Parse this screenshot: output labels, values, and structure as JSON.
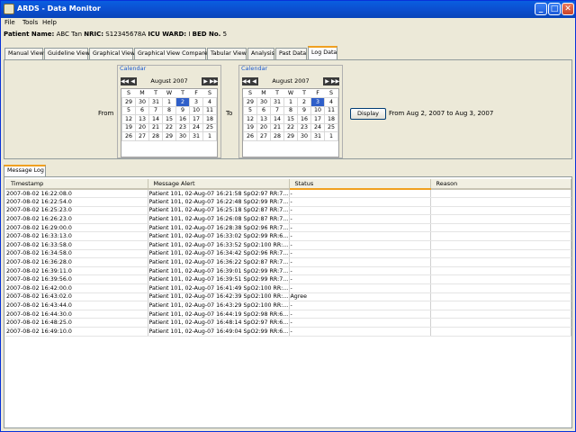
{
  "window": {
    "title": "ARDS - Data Monitor",
    "min_glyph": "_",
    "max_glyph": "□",
    "close_glyph": "✕"
  },
  "menu": [
    "File",
    "Tools",
    "Help"
  ],
  "patient": {
    "name_label": "Patient Name:",
    "name": "ABC Tan",
    "nric_label": "NRIC:",
    "nric": "S12345678A",
    "ward_label": "ICU WARD:",
    "ward": "I",
    "bed_label": "BED No.",
    "bed": "5"
  },
  "tabs": [
    "Manual View",
    "Guideline View",
    "Graphical View",
    "Graphical View Compare",
    "Tabular View",
    "Analysis",
    "Past Data",
    "Log Data"
  ],
  "active_tab": "Log Data",
  "range": {
    "from_label": "From",
    "to_label": "To",
    "display_button": "Display",
    "summary": "From Aug 2, 2007 to Aug 3, 2007"
  },
  "calendars": [
    {
      "title": "Calendar",
      "month": "August 2007",
      "weekdays": [
        "S",
        "M",
        "T",
        "W",
        "T",
        "F",
        "S"
      ],
      "weeks": [
        [
          "29",
          "30",
          "31",
          "1",
          "2",
          "3",
          "4"
        ],
        [
          "5",
          "6",
          "7",
          "8",
          "9",
          "10",
          "11"
        ],
        [
          "12",
          "13",
          "14",
          "15",
          "16",
          "17",
          "18"
        ],
        [
          "19",
          "20",
          "21",
          "22",
          "23",
          "24",
          "25"
        ],
        [
          "26",
          "27",
          "28",
          "29",
          "30",
          "31",
          "1"
        ]
      ],
      "selected": "2"
    },
    {
      "title": "Calendar",
      "month": "August 2007",
      "weekdays": [
        "S",
        "M",
        "T",
        "W",
        "T",
        "F",
        "S"
      ],
      "weeks": [
        [
          "29",
          "30",
          "31",
          "1",
          "2",
          "3",
          "4"
        ],
        [
          "5",
          "6",
          "7",
          "8",
          "9",
          "10",
          "11"
        ],
        [
          "12",
          "13",
          "14",
          "15",
          "16",
          "17",
          "18"
        ],
        [
          "19",
          "20",
          "21",
          "22",
          "23",
          "24",
          "25"
        ],
        [
          "26",
          "27",
          "28",
          "29",
          "30",
          "31",
          "1"
        ]
      ],
      "selected": "3"
    }
  ],
  "calendar_nav": {
    "prev_year": "◀◀",
    "prev_month": "◀",
    "next_month": "▶",
    "next_year": "▶▶"
  },
  "message_log": {
    "tab_label": "Message Log",
    "columns": [
      "Timestamp",
      "Message Alert",
      "Status",
      "Reason"
    ],
    "rows": [
      [
        "2007-08-02 16:22:08.0",
        "Patient 101, 02-Aug-07 16:21:58 SpO2:97 RR:7...",
        "-",
        ""
      ],
      [
        "2007-08-02 16:22:54.0",
        "Patient 101, 02-Aug-07 16:22:48 SpO2:99 RR:7...",
        "-",
        ""
      ],
      [
        "2007-08-02 16:25:23.0",
        "Patient 101, 02-Aug-07 16:25:18 SpO2:87 RR:7...",
        "-",
        ""
      ],
      [
        "2007-08-02 16:26:23.0",
        "Patient 101, 02-Aug-07 16:26:08 SpO2:87 RR:7...",
        "-",
        ""
      ],
      [
        "2007-08-02 16:29:00.0",
        "Patient 101, 02-Aug-07 16:28:38 SpO2:96 RR:7...",
        "-",
        ""
      ],
      [
        "2007-08-02 16:33:13.0",
        "Patient 101, 02-Aug-07 16:33:02 SpO2:99 RR:6...",
        "-",
        ""
      ],
      [
        "2007-08-02 16:33:58.0",
        "Patient 101, 02-Aug-07 16:33:52 SpO2:100 RR:...",
        "-",
        ""
      ],
      [
        "2007-08-02 16:34:58.0",
        "Patient 101, 02-Aug-07 16:34:42 SpO2:96 RR:7...",
        "-",
        ""
      ],
      [
        "2007-08-02 16:36:28.0",
        "Patient 101, 02-Aug-07 16:36:22 SpO2:87 RR:7...",
        "-",
        ""
      ],
      [
        "2007-08-02 16:39:11.0",
        "Patient 101, 02-Aug-07 16:39:01 SpO2:99 RR:7...",
        "-",
        ""
      ],
      [
        "2007-08-02 16:39:56.0",
        "Patient 101, 02-Aug-07 16:39:51 SpO2:99 RR:7...",
        "-",
        ""
      ],
      [
        "2007-08-02 16:42:00.0",
        "Patient 101, 02-Aug-07 16:41:49 SpO2:100 RR:...",
        "-",
        ""
      ],
      [
        "2007-08-02 16:43:02.0",
        "Patient 101, 02-Aug-07 16:42:39 SpO2:100 RR:...",
        "Agree",
        ""
      ],
      [
        "2007-08-02 16:43:44.0",
        "Patient 101, 02-Aug-07 16:43:29 SpO2:100 RR:...",
        "-",
        ""
      ],
      [
        "2007-08-02 16:44:30.0",
        "Patient 101, 02-Aug-07 16:44:19 SpO2:98 RR:6...",
        "-",
        ""
      ],
      [
        "2007-08-02 16:48:25.0",
        "Patient 101, 02-Aug-07 16:48:14 SpO2:97 RR:6...",
        "-",
        ""
      ],
      [
        "2007-08-02 16:49:10.0",
        "Patient 101, 02-Aug-07 16:49:04 SpO2:99 RR:6...",
        "-",
        ""
      ]
    ]
  }
}
